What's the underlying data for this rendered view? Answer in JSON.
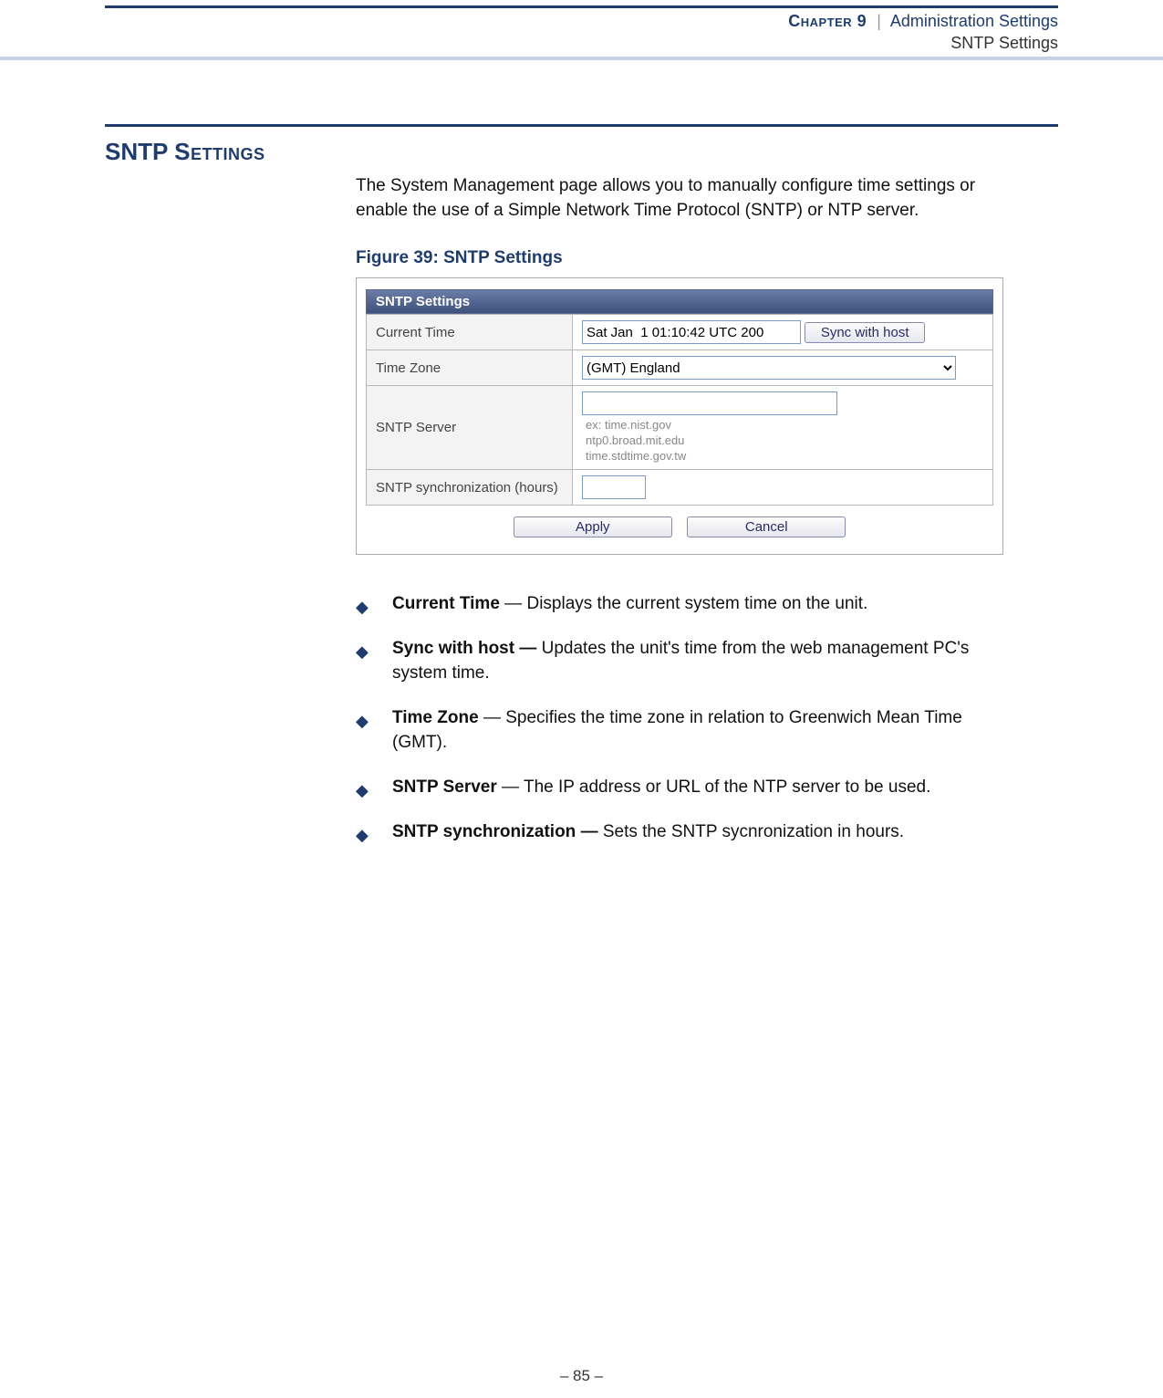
{
  "header": {
    "chapter_label": "Chapter 9",
    "separator": "|",
    "chapter_title": "Administration Settings",
    "subtitle": "SNTP Settings"
  },
  "section": {
    "title_part1": "SNTP ",
    "title_part2": "Settings",
    "intro": "The System Management page allows you to manually configure time settings or enable the use of a Simple Network Time Protocol (SNTP) or NTP server.",
    "figure_caption": "Figure 39:  SNTP Settings"
  },
  "panel": {
    "titlebar": "SNTP Settings",
    "rows": {
      "current_time": {
        "label": "Current Time",
        "value": "Sat Jan  1 01:10:42 UTC 200",
        "sync_label": "Sync with host"
      },
      "time_zone": {
        "label": "Time Zone",
        "value": "(GMT) England"
      },
      "sntp_server": {
        "label": "SNTP Server",
        "value": "",
        "hint": "ex: time.nist.gov\n     ntp0.broad.mit.edu\n     time.stdtime.gov.tw"
      },
      "sync_hours": {
        "label": "SNTP synchronization (hours)",
        "value": ""
      }
    },
    "buttons": {
      "apply": "Apply",
      "cancel": "Cancel"
    }
  },
  "bullets": [
    {
      "term": "Current Time",
      "sep": " — ",
      "desc": "Displays the current system time on the unit."
    },
    {
      "term": "Sync with host — ",
      "sep": "",
      "desc": "Updates the unit's time from the web management PC's system time."
    },
    {
      "term": "Time Zone",
      "sep": " — ",
      "desc": "Specifies the time zone in relation to Greenwich Mean Time (GMT)."
    },
    {
      "term": "SNTP Server",
      "sep": " — ",
      "desc": "The IP address or URL of the NTP server to be used."
    },
    {
      "term": "SNTP synchronization — ",
      "sep": "",
      "desc": "Sets the SNTP sycnronization in hours."
    }
  ],
  "footer": {
    "page": "–  85  –"
  }
}
